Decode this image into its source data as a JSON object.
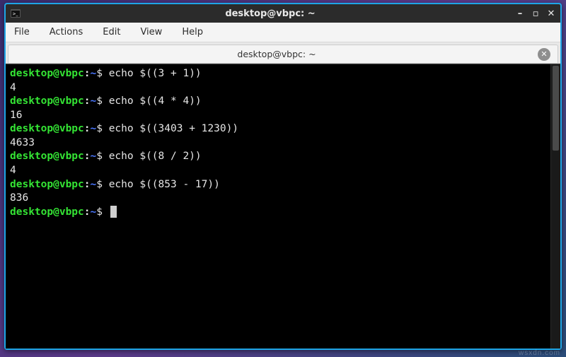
{
  "window": {
    "title": "desktop@vbpc: ~"
  },
  "menubar": {
    "file": "File",
    "actions": "Actions",
    "edit": "Edit",
    "view": "View",
    "help": "Help"
  },
  "tab": {
    "label": "desktop@vbpc: ~"
  },
  "prompt": {
    "user_host": "desktop@vbpc",
    "path": "~",
    "symbol": "$"
  },
  "session": [
    {
      "cmd": "echo $((3 + 1))",
      "out": "4"
    },
    {
      "cmd": "echo $((4 * 4))",
      "out": "16"
    },
    {
      "cmd": "echo $((3403 + 1230))",
      "out": "4633"
    },
    {
      "cmd": "echo $((8 / 2))",
      "out": "4"
    },
    {
      "cmd": "echo $((853 - 17))",
      "out": "836"
    }
  ],
  "watermark": "wsxdn.com"
}
